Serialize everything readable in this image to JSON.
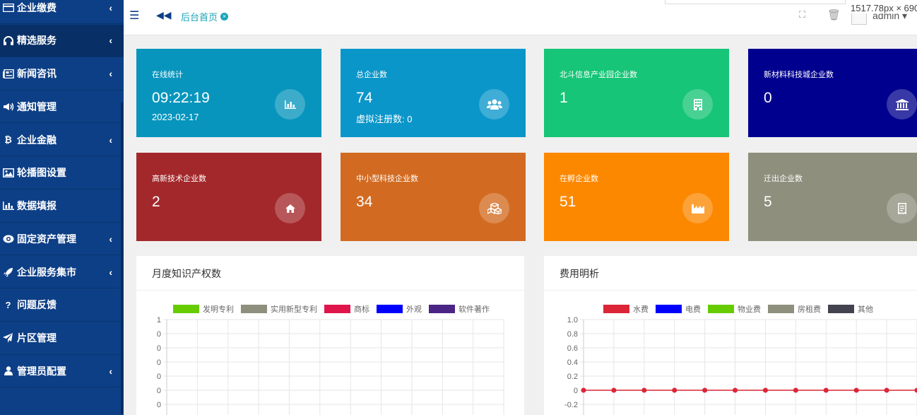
{
  "sidebar": {
    "items": [
      {
        "label": "企业缴费",
        "icon": "credit-card-icon",
        "has_children": true,
        "active": false
      },
      {
        "label": "精选服务",
        "icon": "headphones-icon",
        "has_children": true,
        "active": true
      },
      {
        "label": "新闻咨讯",
        "icon": "newspaper-icon",
        "has_children": true,
        "active": false
      },
      {
        "label": "通知管理",
        "icon": "bullhorn-icon",
        "has_children": false,
        "active": false
      },
      {
        "label": "企业金融",
        "icon": "bitcoin-icon",
        "has_children": true,
        "active": false
      },
      {
        "label": "轮播图设置",
        "icon": "image-icon",
        "has_children": false,
        "active": false
      },
      {
        "label": "数据填报",
        "icon": "bar-chart-icon",
        "has_children": false,
        "active": false
      },
      {
        "label": "固定资产管理",
        "icon": "eye-icon",
        "has_children": true,
        "active": false
      },
      {
        "label": "企业服务集市",
        "icon": "rocket-icon",
        "has_children": true,
        "active": false
      },
      {
        "label": "问题反馈",
        "icon": "question-icon",
        "has_children": false,
        "active": false
      },
      {
        "label": "片区管理",
        "icon": "paper-plane-icon",
        "has_children": false,
        "active": false
      },
      {
        "label": "管理员配置",
        "icon": "user-icon",
        "has_children": true,
        "active": false
      }
    ]
  },
  "topbar": {
    "tab_label": "后台首页",
    "user_name": "admin",
    "dimension_text": "1517.78px × 690"
  },
  "cards": [
    {
      "title": "在线统计",
      "value": "09:22:19",
      "sub": "2023-02-17",
      "color": "#0795bd",
      "icon": "bar-chart-icon"
    },
    {
      "title": "总企业数",
      "value": "74",
      "sub": "虚拟注册数: 0",
      "color": "#0a96c9",
      "icon": "users-icon"
    },
    {
      "title": "北斗信息产业园企业数",
      "value": "1",
      "sub": "",
      "color": "#16c577",
      "icon": "building-icon"
    },
    {
      "title": "新材料科技城企业数",
      "value": "0",
      "sub": "",
      "color": "#00008e",
      "icon": "bank-icon"
    },
    {
      "title": "高新技术企业数",
      "value": "2",
      "sub": "",
      "color": "#a3282b",
      "icon": "home-icon"
    },
    {
      "title": "中小型科技企业数",
      "value": "34",
      "sub": "",
      "color": "#d26b21",
      "icon": "cubes-icon"
    },
    {
      "title": "在孵企业数",
      "value": "51",
      "sub": "",
      "color": "#fc8800",
      "icon": "industry-icon"
    },
    {
      "title": "迁出企业数",
      "value": "5",
      "sub": "",
      "color": "#8f8f7e",
      "icon": "receipt-icon"
    }
  ],
  "panels": {
    "left_title": "月度知识产权数",
    "right_title": "费用明析"
  },
  "chart_data": [
    {
      "type": "line",
      "series": [
        {
          "name": "发明专利",
          "color": "#66cc00",
          "values": []
        },
        {
          "name": "实用新型专利",
          "color": "#8f8f7e",
          "values": []
        },
        {
          "name": "商标",
          "color": "#e0154b",
          "values": []
        },
        {
          "name": "外观",
          "color": "#0000ff",
          "values": []
        },
        {
          "name": "软件著作",
          "color": "#4a2585",
          "values": []
        }
      ],
      "y_ticks": [
        "1",
        "0",
        "0",
        "0",
        "0",
        "0",
        "0"
      ],
      "grid": true,
      "legend": "top"
    },
    {
      "type": "line",
      "x_count": 12,
      "series": [
        {
          "name": "水费",
          "color": "#dc2537",
          "values": [
            0,
            0,
            0,
            0,
            0,
            0,
            0,
            0,
            0,
            0,
            0,
            0
          ]
        },
        {
          "name": "电费",
          "color": "#0000ff",
          "values": []
        },
        {
          "name": "物业费",
          "color": "#66cc00",
          "values": []
        },
        {
          "name": "房租费",
          "color": "#8f8f7e",
          "values": []
        },
        {
          "name": "其他",
          "color": "#434350",
          "values": []
        }
      ],
      "y_ticks": [
        "1.0",
        "0.8",
        "0.6",
        "0.4",
        "0.2",
        "0",
        "-0.2"
      ],
      "ylim": [
        -0.2,
        1.0
      ],
      "grid": true,
      "legend": "top"
    }
  ]
}
